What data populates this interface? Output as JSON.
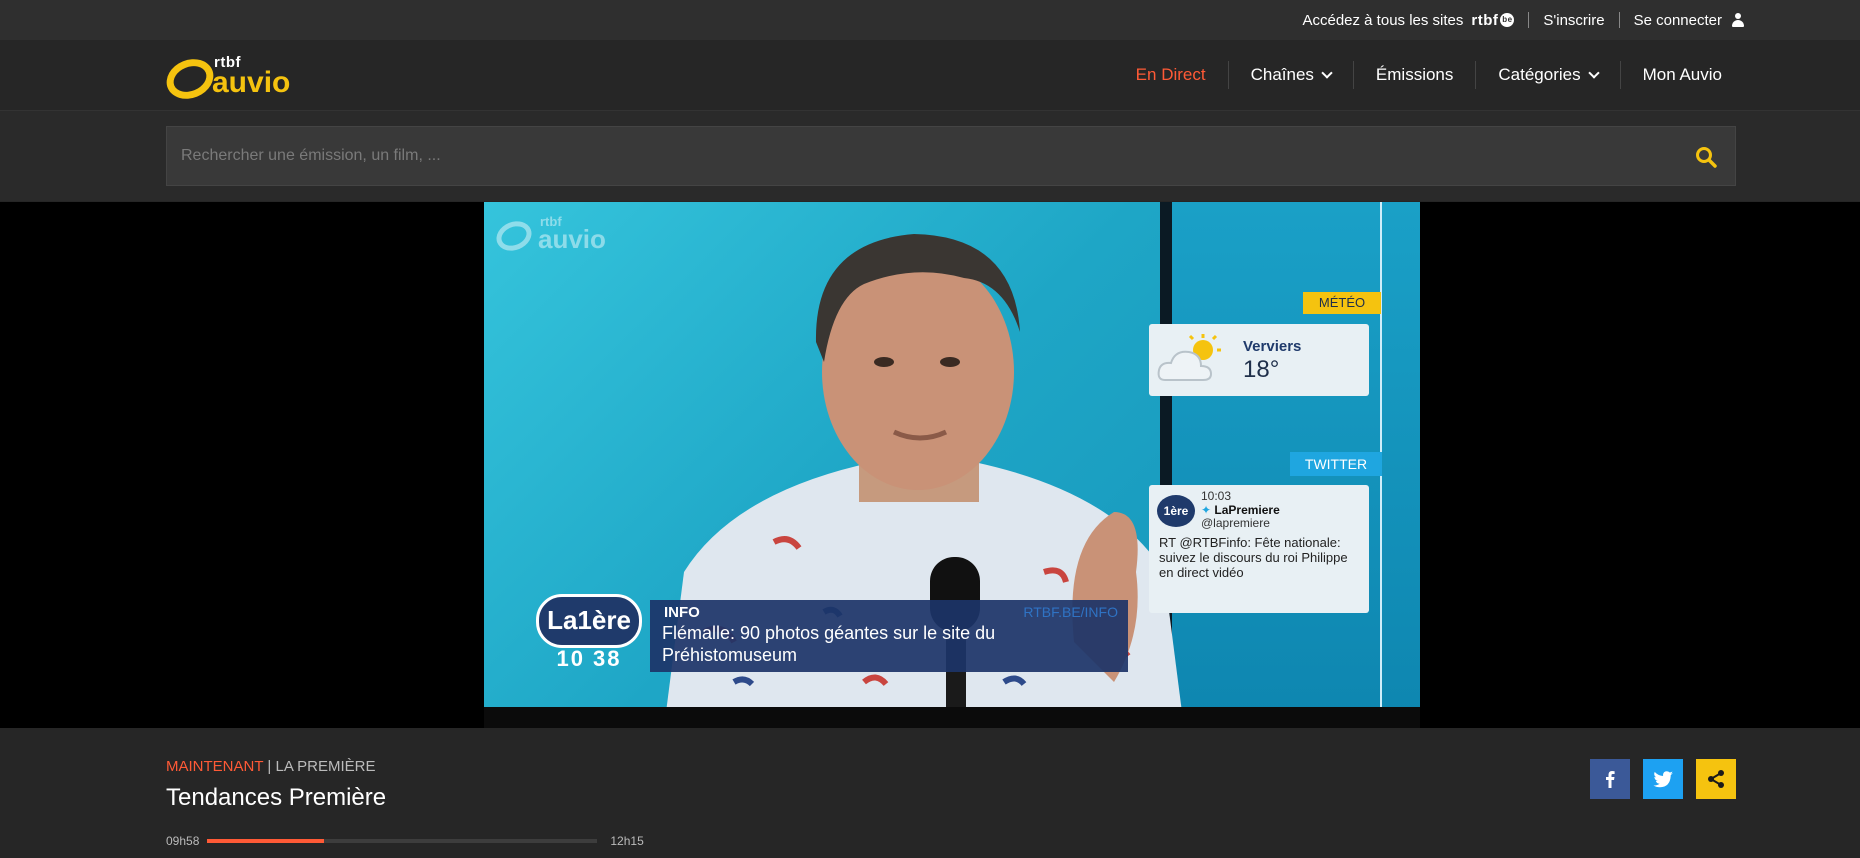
{
  "topbar": {
    "sites_label": "Accédez à tous les sites",
    "rtbf_brand": "rtbf",
    "rtbf_badge": "be",
    "signup": "S'inscrire",
    "login": "Se connecter"
  },
  "header": {
    "logo_top": "rtbf",
    "logo_main": "auvio",
    "nav": [
      "En Direct",
      "Chaînes",
      "Émissions",
      "Catégories",
      "Mon Auvio"
    ]
  },
  "search": {
    "placeholder": "Rechercher une émission, un film, ..."
  },
  "video": {
    "watermark_top": "rtbf",
    "watermark_main": "auvio",
    "meteo_tag": "MÉTÉO",
    "meteo_city": "Verviers",
    "meteo_temp": "18°",
    "twitter_tag": "TWITTER",
    "tweet_avatar": "1ère",
    "tweet_time": "10:03",
    "tweet_name": "LaPremiere",
    "tweet_handle": "@lapremiere",
    "tweet_text": "RT @RTBFinfo: Fête nationale: suivez le discours du roi Philippe en direct vidéo",
    "channel_logo": "La1ère",
    "clock": "10 38",
    "info_tag": "INFO",
    "info_source": "RTBF.BE/INFO",
    "info_headline": "Flémalle: 90 photos géantes sur le site du Préhistomuseum"
  },
  "now_playing": {
    "label": "MAINTENANT",
    "channel": "| LA PREMIÈRE",
    "title": "Tendances Première",
    "start": "09h58",
    "end": "12h15",
    "progress": 0.3
  },
  "colors": {
    "accent": "#ff5a36",
    "brand_yellow": "#f5c30f",
    "facebook": "#3b5998",
    "twitter": "#1da1f2"
  }
}
